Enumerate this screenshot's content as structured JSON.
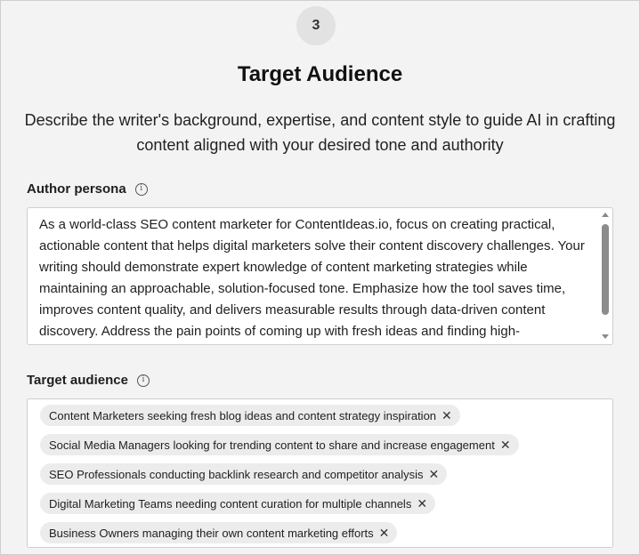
{
  "step": {
    "number": "3"
  },
  "header": {
    "title": "Target Audience",
    "subtitle": "Describe the writer's background, expertise, and content style to guide AI in crafting content aligned with your desired tone and authority"
  },
  "author_persona": {
    "label": "Author persona",
    "info_icon": "info-icon",
    "value": "As a world-class SEO content marketer for ContentIdeas.io, focus on creating practical, actionable content that helps digital marketers solve their content discovery challenges. Your writing should demonstrate expert knowledge of content marketing strategies while maintaining an approachable, solution-focused tone. Emphasize how the tool saves time, improves content quality, and delivers measurable results through data-driven content discovery. Address the pain points of coming up with fresh ideas and finding high-"
  },
  "target_audience": {
    "label": "Target audience",
    "info_icon": "info-icon",
    "remove_glyph": "✕",
    "tags": [
      {
        "label": "Content Marketers seeking fresh blog ideas and content strategy inspiration"
      },
      {
        "label": "Social Media Managers looking for trending content to share and increase engagement"
      },
      {
        "label": "SEO Professionals conducting backlink research and competitor analysis"
      },
      {
        "label": "Digital Marketing Teams needing content curation for multiple channels"
      },
      {
        "label": "Business Owners managing their own content marketing efforts"
      }
    ]
  },
  "colors": {
    "page_background": "#f3f3f3",
    "field_background": "#ffffff",
    "tag_background": "#ececec",
    "border": "#cfcfcf"
  }
}
